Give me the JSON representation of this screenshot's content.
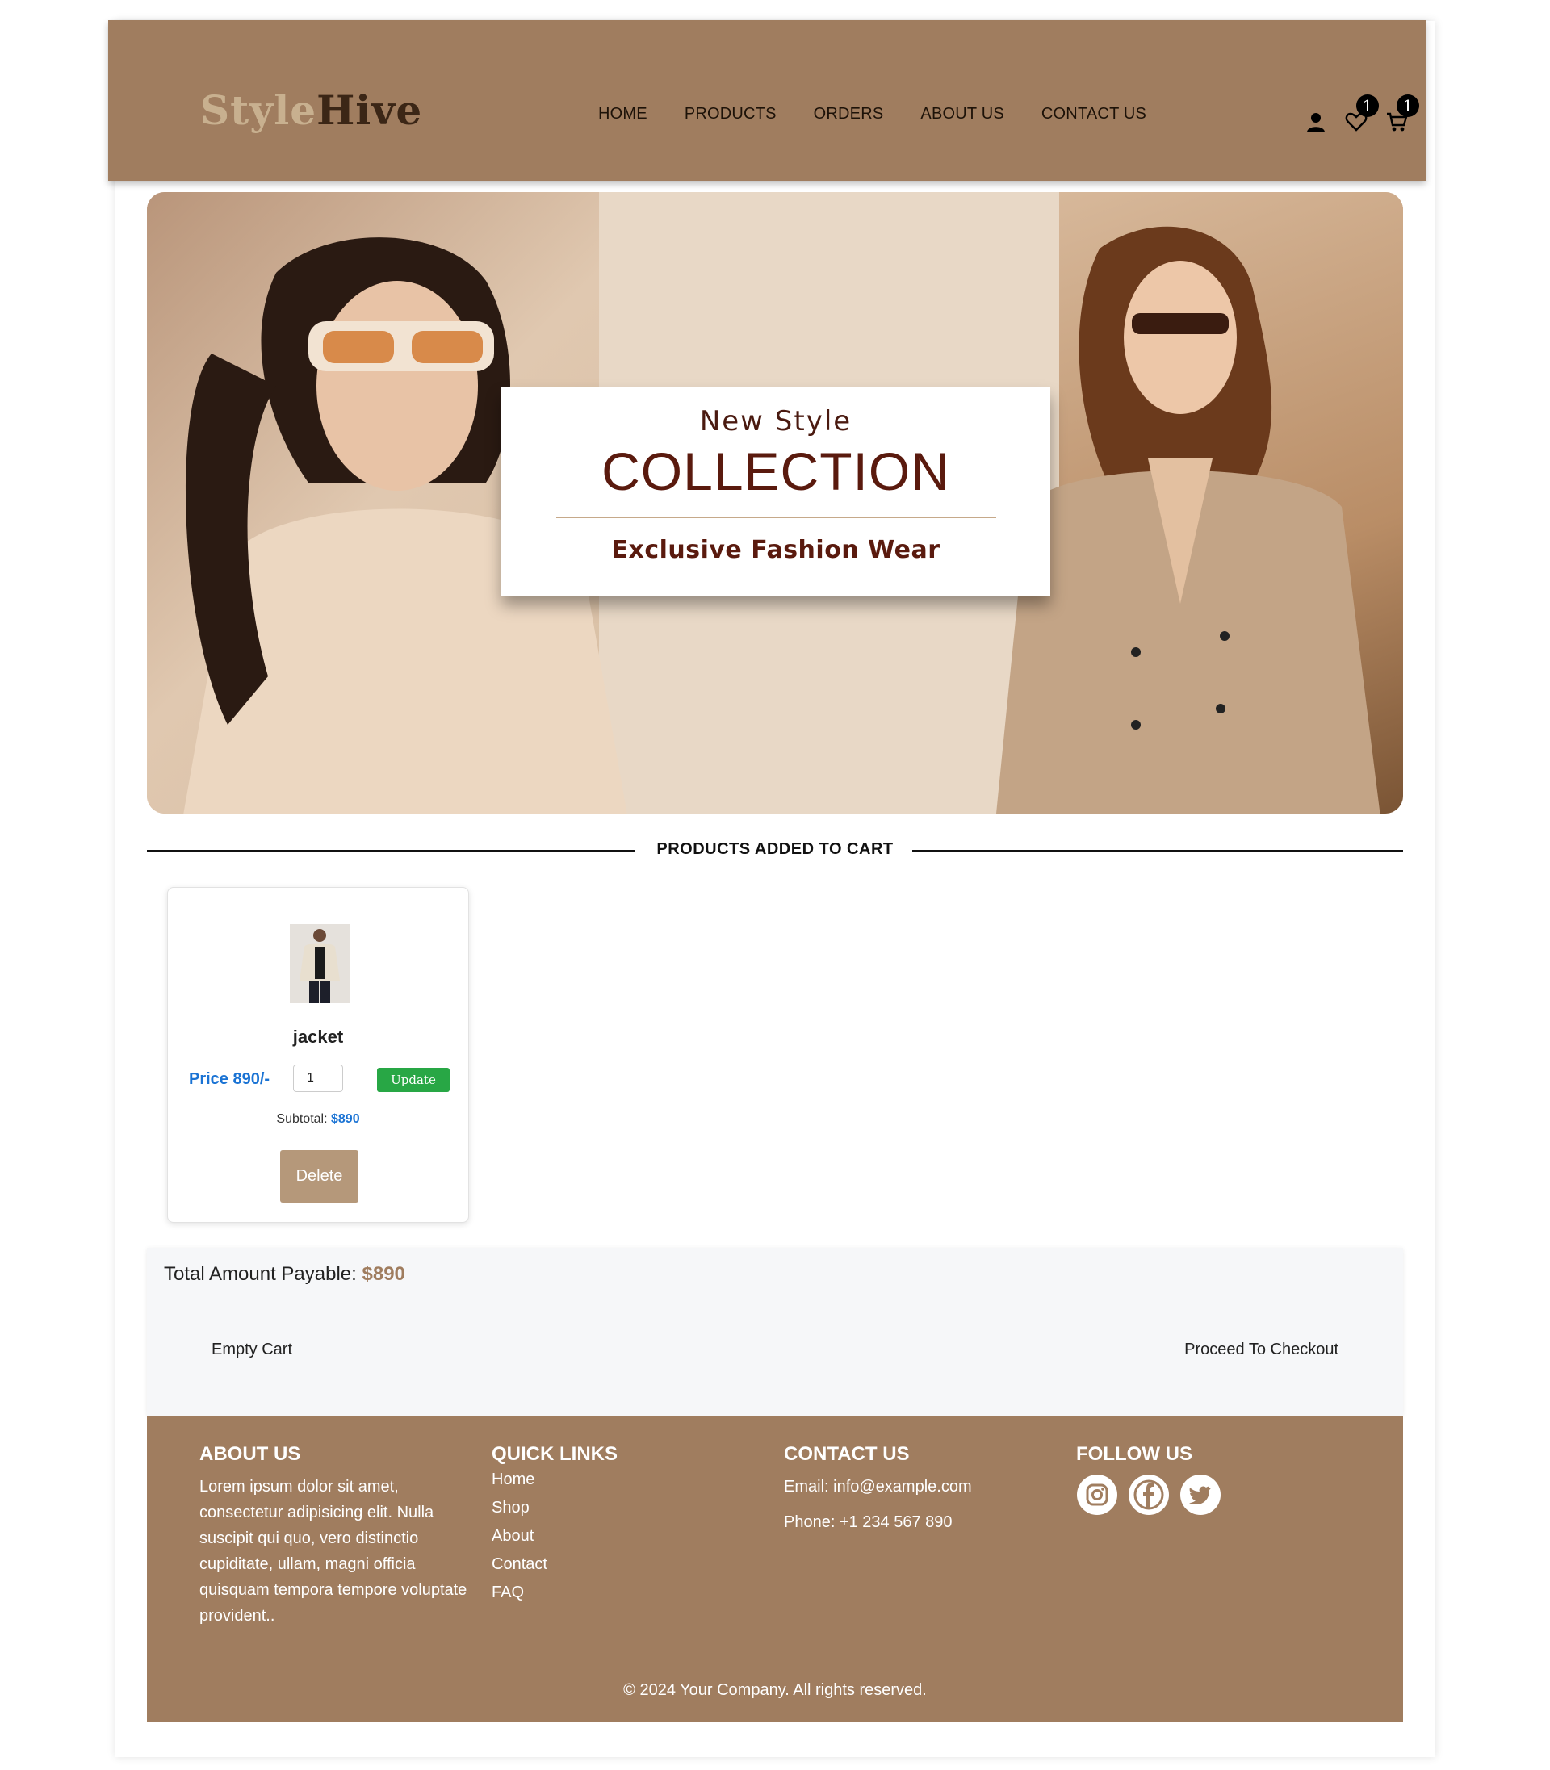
{
  "header": {
    "logo_part1": "Style",
    "logo_part2": "Hive",
    "nav": [
      "HOME",
      "PRODUCTS",
      "ORDERS",
      "ABOUT US",
      "CONTACT US"
    ],
    "wishlist_count": "1",
    "cart_count": "1",
    "icons": [
      "user-icon",
      "heart-icon",
      "cart-icon"
    ]
  },
  "banner": {
    "script_text": "New Style",
    "title": "COLLECTION",
    "subtitle": "Exclusive Fashion Wear"
  },
  "cart": {
    "section_title": "PRODUCTS ADDED TO CART",
    "items": [
      {
        "name": "jacket",
        "price": "Price 890/-",
        "quantity": "1",
        "update_label": "Update",
        "subtotal_label": "Subtotal:",
        "subtotal_value": "$890",
        "delete_label": "Delete"
      }
    ],
    "total_label": "Total Amount Payable:",
    "total_value": "$890",
    "empty_label": "Empty Cart",
    "checkout_label": "Proceed To Checkout"
  },
  "footer": {
    "about_title": "ABOUT US",
    "about_text": "Lorem ipsum dolor sit amet, consectetur adipisicing elit. Nulla suscipit qui quo, vero distinctio cupiditate, ullam, magni officia quisquam tempora tempore voluptate provident..",
    "links_title": "QUICK LINKS",
    "links": [
      "Home",
      "Shop",
      "About",
      "Contact",
      "FAQ"
    ],
    "contact_title": "CONTACT US",
    "email": "Email: info@example.com",
    "phone": "Phone: +1 234 567 890",
    "follow_title": "FOLLOW US",
    "social_icons": [
      "instagram-icon",
      "facebook-icon",
      "twitter-icon"
    ],
    "copyright": "© 2024 Your Company. All rights reserved."
  },
  "colors": {
    "brand": "#a07d5f",
    "price_blue": "#1a73d4",
    "update_green": "#28a745",
    "delete_tan": "#b5987a"
  }
}
